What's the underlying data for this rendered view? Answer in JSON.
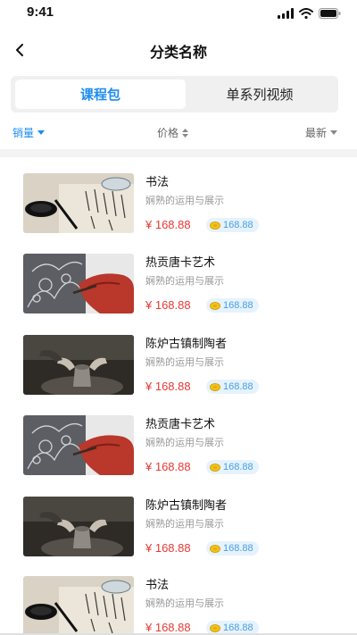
{
  "status": {
    "time": "9:41"
  },
  "nav": {
    "title": "分类名称"
  },
  "tabs": [
    {
      "label": "课程包",
      "active": true
    },
    {
      "label": "单系列视频",
      "active": false
    }
  ],
  "filters": [
    {
      "label": "销量",
      "icon": "caret-down-icon"
    },
    {
      "label": "价格",
      "icon": "sort-icon"
    },
    {
      "label": "最新",
      "icon": "caret-down-icon"
    }
  ],
  "courses": [
    {
      "title": "书法",
      "subtitle": "娴熟的运用与展示",
      "price": "¥ 168.88",
      "coin": "168.88",
      "image": "calligraphy"
    },
    {
      "title": "热贡唐卡艺术",
      "subtitle": "娴熟的运用与展示",
      "price": "¥ 168.88",
      "coin": "168.88",
      "image": "thangka"
    },
    {
      "title": "陈炉古镇制陶者",
      "subtitle": "娴熟的运用与展示",
      "price": "¥ 168.88",
      "coin": "168.88",
      "image": "pottery"
    },
    {
      "title": "热贡唐卡艺术",
      "subtitle": "娴熟的运用与展示",
      "price": "¥ 168.88",
      "coin": "168.88",
      "image": "thangka"
    },
    {
      "title": "陈炉古镇制陶者",
      "subtitle": "娴熟的运用与展示",
      "price": "¥ 168.88",
      "coin": "168.88",
      "image": "pottery"
    },
    {
      "title": "书法",
      "subtitle": "娴熟的运用与展示",
      "price": "¥ 168.88",
      "coin": "168.88",
      "image": "calligraphy"
    }
  ],
  "colors": {
    "accent": "#1e8cf0",
    "price": "#e53935",
    "coin_bg": "#e6f3fd",
    "coin_text": "#4a9ee0"
  }
}
